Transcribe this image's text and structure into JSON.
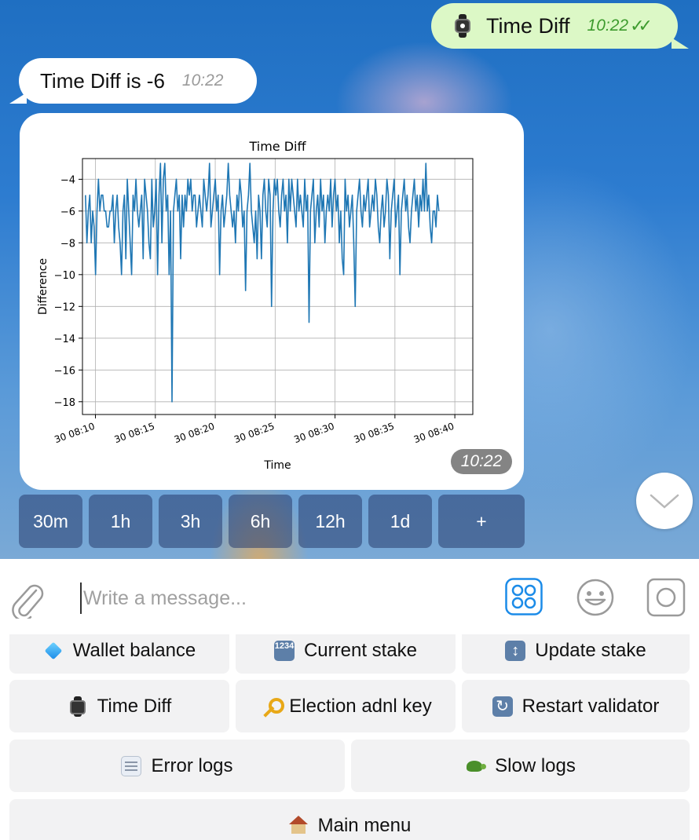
{
  "messages": {
    "outgoing": {
      "text": "Time Diff",
      "time": "10:22",
      "icon": "watch-icon"
    },
    "incoming_text": {
      "text": "Time Diff is -6",
      "time": "10:22"
    },
    "photo": {
      "time": "10:22"
    }
  },
  "inline_keyboard": [
    "30m",
    "1h",
    "3h",
    "6h",
    "12h",
    "1d",
    "+"
  ],
  "composer": {
    "placeholder": "Write a message..."
  },
  "reply_keyboard": {
    "wallet_balance": "Wallet balance",
    "current_stake": "Current stake",
    "current_stake_icon": "1234",
    "update_stake": "Update stake",
    "time_diff": "Time Diff",
    "election_adnl_key": "Election adnl key",
    "restart_validator": "Restart validator",
    "error_logs": "Error logs",
    "slow_logs": "Slow logs",
    "main_menu": "Main menu"
  },
  "colors": {
    "outgoing_bubble": "#dcf8c6",
    "series": "#1f77b4",
    "accent": "#1b8be8"
  },
  "chart_data": {
    "type": "line",
    "title": "Time Diff",
    "xlabel": "Time",
    "ylabel": "Difference",
    "ylim": [
      -18.8,
      -2.7
    ],
    "yticks": [
      -4,
      -6,
      -8,
      -10,
      -12,
      -14,
      -16,
      -18
    ],
    "xticks": [
      "30 08:10",
      "30 08:15",
      "30 08:20",
      "30 08:25",
      "30 08:30",
      "30 08:35",
      "30 08:40"
    ],
    "xlim": [
      "08:08:55",
      "08:41:30"
    ],
    "grid": true,
    "series": [
      {
        "x_start": "08:09:10",
        "x_end": "08:38:40",
        "values": [
          -5,
          -8,
          -6,
          -5,
          -8,
          -6,
          -7,
          -10,
          -6,
          -4,
          -6,
          -5,
          -5,
          -6,
          -6,
          -7,
          -7,
          -6,
          -6,
          -5,
          -8,
          -6,
          -5,
          -7,
          -8,
          -10,
          -6,
          -5,
          -9,
          -4,
          -6,
          -8,
          -10,
          -5,
          -6,
          -4,
          -6,
          -7,
          -6,
          -5,
          -9,
          -4,
          -5,
          -6,
          -8,
          -9,
          -4,
          -7,
          -6,
          -4,
          -10,
          -5,
          -3,
          -8,
          -4,
          -3,
          -6,
          -5,
          -10,
          -6,
          -18,
          -6,
          -5,
          -4,
          -6,
          -5,
          -9,
          -5,
          -7,
          -5,
          -6,
          -4,
          -5,
          -4,
          -6,
          -5,
          -5,
          -7,
          -6,
          -5,
          -6,
          -7,
          -4,
          -5,
          -6,
          -5,
          -3,
          -7,
          -6,
          -5,
          -4,
          -6,
          -5,
          -10,
          -6,
          -5,
          -7,
          -6,
          -5,
          -3,
          -5,
          -6,
          -7,
          -6,
          -8,
          -5,
          -6,
          -4,
          -5,
          -7,
          -6,
          -11,
          -6,
          -5,
          -3,
          -6,
          -7,
          -8,
          -6,
          -9,
          -5,
          -6,
          -9,
          -5,
          -4,
          -6,
          -7,
          -4,
          -5,
          -12,
          -6,
          -4,
          -5,
          -4,
          -6,
          -7,
          -5,
          -4,
          -6,
          -5,
          -8,
          -4,
          -6,
          -4,
          -5,
          -6,
          -7,
          -4,
          -6,
          -5,
          -6,
          -7,
          -4,
          -6,
          -5,
          -13,
          -6,
          -5,
          -4,
          -8,
          -6,
          -5,
          -7,
          -4,
          -6,
          -5,
          -8,
          -6,
          -5,
          -6,
          -4,
          -7,
          -5,
          -4,
          -6,
          -5,
          -8,
          -6,
          -9,
          -10,
          -4,
          -6,
          -5,
          -7,
          -6,
          -5,
          -8,
          -12,
          -6,
          -5,
          -4,
          -6,
          -7,
          -5,
          -6,
          -5,
          -4,
          -7,
          -6,
          -5,
          -6,
          -4,
          -5,
          -7,
          -8,
          -6,
          -5,
          -7,
          -6,
          -4,
          -5,
          -9,
          -6,
          -5,
          -4,
          -7,
          -6,
          -5,
          -10,
          -6,
          -5,
          -4,
          -6,
          -5,
          -7,
          -8,
          -6,
          -5,
          -4,
          -6,
          -5,
          -7,
          -5,
          -6,
          -4,
          -6,
          -3,
          -6,
          -5,
          -7,
          -8,
          -6,
          -6,
          -7,
          -5,
          -6
        ]
      }
    ]
  }
}
